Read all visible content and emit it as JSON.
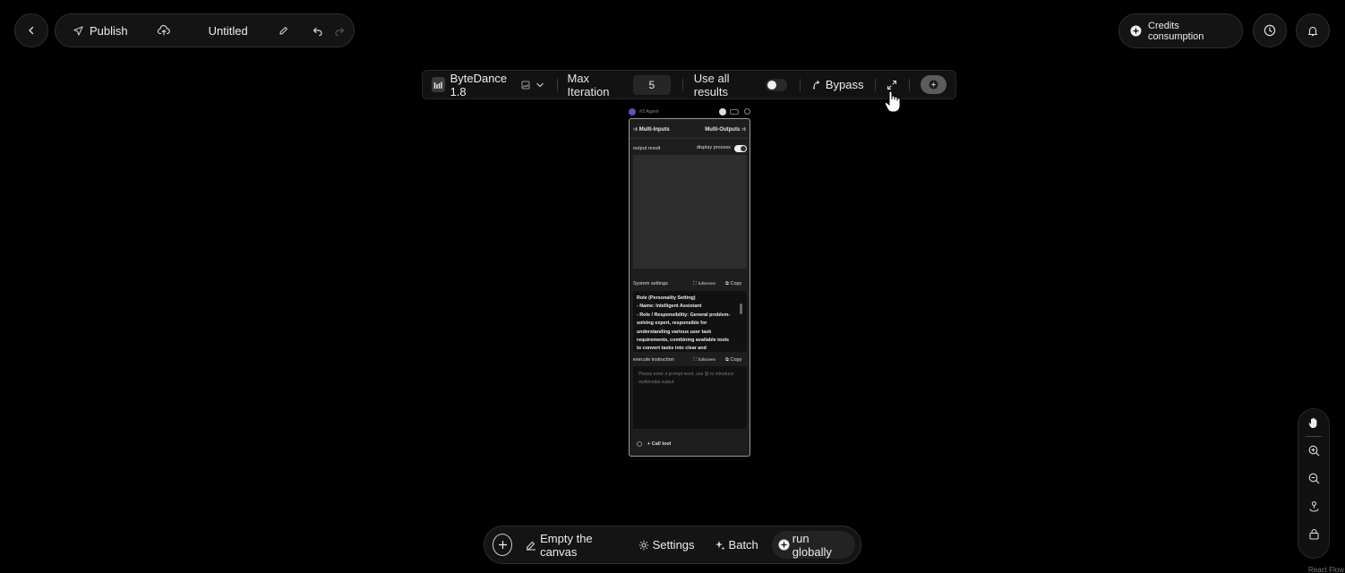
{
  "header": {
    "publish_label": "Publish",
    "title": "Untitled",
    "credits_label": "Credits consumption"
  },
  "toolbar": {
    "model_name": "ByteDance 1.8",
    "max_iteration_label": "Max Iteration",
    "max_iteration_value": "5",
    "use_all_results_label": "Use all results",
    "use_all_results_on": false,
    "bypass_label": "Bypass"
  },
  "node": {
    "name": "#3 Agent",
    "inputs_label": "Multi-Inputs",
    "outputs_label": "Multi-Outputs",
    "output_result_label": "output result",
    "display_process_label": "display process",
    "system_settings_label": "System settings",
    "fullscreen_label": "fullscreen",
    "copy_label": "Copy",
    "system_text_lines": [
      "Role (Personality Setting)",
      "- Name: Intelligent Assistant",
      "- Role / Responsibility: General problem-",
      "solving expert, responsible for",
      "understanding various user task",
      "requirements, combining available tools",
      "to convert tasks into clear and"
    ],
    "execute_label": "execute instruction",
    "execute_placeholder": "Please enter a prompt word, use @ to introduce multimodal output",
    "call_tool_label": "+ Call tool"
  },
  "bottom_bar": {
    "empty_canvas_label": "Empty the canvas",
    "settings_label": "Settings",
    "batch_label": "Batch",
    "run_label": "run globally"
  },
  "attribution": "React Flow"
}
